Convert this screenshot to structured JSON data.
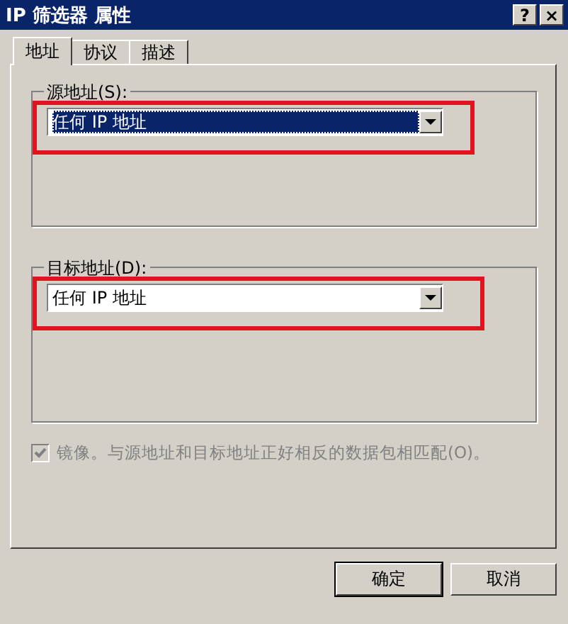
{
  "window": {
    "title": "IP 筛选器 属性",
    "buttons": [
      "?",
      "×"
    ]
  },
  "tabs": [
    {
      "label": "地址",
      "selected": true
    },
    {
      "label": "协议",
      "selected": false
    },
    {
      "label": "描述",
      "selected": false
    }
  ],
  "address_groups": [
    {
      "label": "源地址(S):",
      "value": "任何 IP 地址",
      "focused": true,
      "highlighted": true
    },
    {
      "label": "目标地址(D):",
      "value": "任何 IP 地址",
      "focused": false,
      "highlighted": true
    }
  ],
  "mirror": {
    "label": "镜像。与源地址和目标地址正好相反的数据包相匹配(O)。",
    "checked": true,
    "disabled": true
  },
  "buttons": [
    "确定",
    "取消"
  ]
}
